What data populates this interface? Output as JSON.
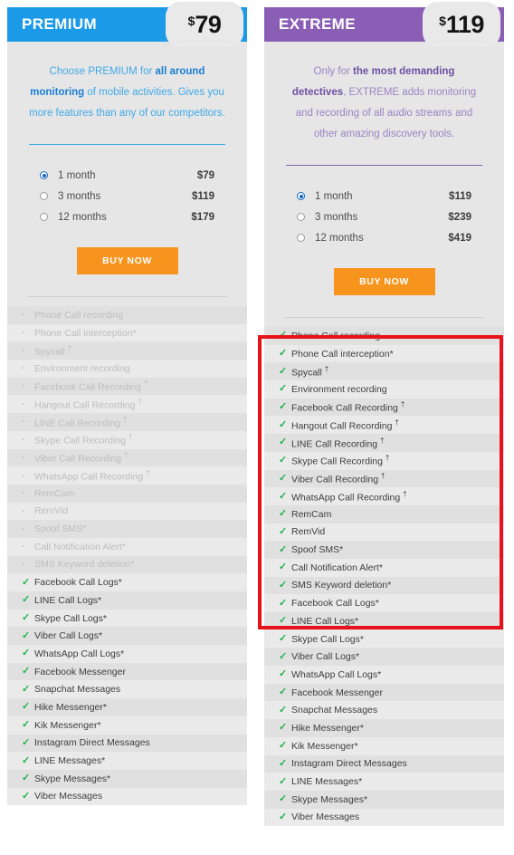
{
  "cards": [
    {
      "id": "premium",
      "name": "PREMIUM",
      "accent": "#1b9ae8",
      "price_currency": "$",
      "price_amount": "79",
      "blurb_parts": [
        {
          "text": "Choose PREMIUM for ",
          "bold": false
        },
        {
          "text": "all around monitoring",
          "bold": true
        },
        {
          "text": " of mobile activities. Gives you more features than any of our competitors.",
          "bold": false
        }
      ],
      "plans": [
        {
          "label": "1 month",
          "price": "$79",
          "selected": true
        },
        {
          "label": "3 months",
          "price": "$119",
          "selected": false
        },
        {
          "label": "12 months",
          "price": "$179",
          "selected": false
        }
      ],
      "buy_label": "BUY NOW",
      "features": [
        {
          "label": "Phone Call recording",
          "included": false
        },
        {
          "label": "Phone Call interception*",
          "included": false
        },
        {
          "label": "Spycall †",
          "included": false
        },
        {
          "label": "Environment recording",
          "included": false
        },
        {
          "label": "Facebook Call Recording †",
          "included": false
        },
        {
          "label": "Hangout Call Recording †",
          "included": false
        },
        {
          "label": "LINE Call Recording †",
          "included": false
        },
        {
          "label": "Skype Call Recording †",
          "included": false
        },
        {
          "label": "Viber Call Recording †",
          "included": false
        },
        {
          "label": "WhatsApp Call Recording †",
          "included": false
        },
        {
          "label": "RemCam",
          "included": false
        },
        {
          "label": "RemVid",
          "included": false
        },
        {
          "label": "Spoof SMS*",
          "included": false
        },
        {
          "label": "Call Notification Alert*",
          "included": false
        },
        {
          "label": "SMS Keyword deletion*",
          "included": false
        },
        {
          "label": "Facebook Call Logs*",
          "included": true
        },
        {
          "label": "LINE Call Logs*",
          "included": true
        },
        {
          "label": "Skype Call Logs*",
          "included": true
        },
        {
          "label": "Viber Call Logs*",
          "included": true
        },
        {
          "label": "WhatsApp Call Logs*",
          "included": true
        },
        {
          "label": "Facebook Messenger",
          "included": true
        },
        {
          "label": "Snapchat Messages",
          "included": true
        },
        {
          "label": "Hike Messenger*",
          "included": true
        },
        {
          "label": "Kik Messenger*",
          "included": true
        },
        {
          "label": "Instagram Direct Messages",
          "included": true
        },
        {
          "label": "LINE Messages*",
          "included": true
        },
        {
          "label": "Skype Messages*",
          "included": true
        },
        {
          "label": "Viber Messages",
          "included": true
        }
      ]
    },
    {
      "id": "extreme",
      "name": "EXTREME",
      "accent": "#8b5eb5",
      "price_currency": "$",
      "price_amount": "119",
      "blurb_parts": [
        {
          "text": "Only for ",
          "bold": false
        },
        {
          "text": "the most demanding detectives",
          "bold": true
        },
        {
          "text": ", EXTREME adds monitoring and recording of all audio streams and other amazing discovery tools.",
          "bold": false
        }
      ],
      "plans": [
        {
          "label": "1 month",
          "price": "$119",
          "selected": true
        },
        {
          "label": "3 months",
          "price": "$239",
          "selected": false
        },
        {
          "label": "12 months",
          "price": "$419",
          "selected": false
        }
      ],
      "buy_label": "BUY NOW",
      "features": [
        {
          "label": "Phone Call recording",
          "included": true
        },
        {
          "label": "Phone Call interception*",
          "included": true
        },
        {
          "label": "Spycall †",
          "included": true
        },
        {
          "label": "Environment recording",
          "included": true
        },
        {
          "label": "Facebook Call Recording †",
          "included": true
        },
        {
          "label": "Hangout Call Recording †",
          "included": true
        },
        {
          "label": "LINE Call Recording †",
          "included": true
        },
        {
          "label": "Skype Call Recording †",
          "included": true
        },
        {
          "label": "Viber Call Recording †",
          "included": true
        },
        {
          "label": "WhatsApp Call Recording †",
          "included": true
        },
        {
          "label": "RemCam",
          "included": true
        },
        {
          "label": "RemVid",
          "included": true
        },
        {
          "label": "Spoof SMS*",
          "included": true
        },
        {
          "label": "Call Notification Alert*",
          "included": true
        },
        {
          "label": "SMS Keyword deletion*",
          "included": true
        },
        {
          "label": "Facebook Call Logs*",
          "included": true
        },
        {
          "label": "LINE Call Logs*",
          "included": true
        },
        {
          "label": "Skype Call Logs*",
          "included": true
        },
        {
          "label": "Viber Call Logs*",
          "included": true
        },
        {
          "label": "WhatsApp Call Logs*",
          "included": true
        },
        {
          "label": "Facebook Messenger",
          "included": true
        },
        {
          "label": "Snapchat Messages",
          "included": true
        },
        {
          "label": "Hike Messenger*",
          "included": true
        },
        {
          "label": "Kik Messenger*",
          "included": true
        },
        {
          "label": "Instagram Direct Messages",
          "included": true
        },
        {
          "label": "LINE Messages*",
          "included": true
        },
        {
          "label": "Skype Messages*",
          "included": true
        },
        {
          "label": "Viber Messages",
          "included": true
        }
      ]
    }
  ],
  "glyphs": {
    "check": "✓",
    "dash": "-"
  },
  "highlight": {
    "color": "#e8121a",
    "first_feature": "Phone Call recording",
    "last_feature": "SMS Keyword deletion*"
  }
}
